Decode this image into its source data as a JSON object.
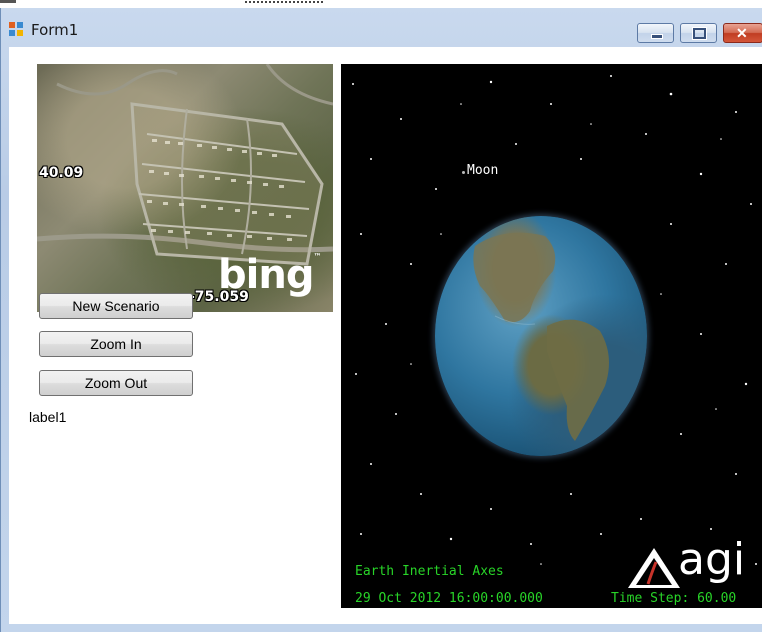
{
  "window": {
    "title": "Form1",
    "minimize_label": "minimize",
    "maximize_label": "maximize",
    "close_label": "close",
    "close_glyph": "✕"
  },
  "map": {
    "provider_logo": "bing",
    "latitude_label": "40.09",
    "longitude_label": "-75.059"
  },
  "buttons": {
    "new_scenario": "New Scenario",
    "zoom_in": "Zoom In",
    "zoom_out": "Zoom Out"
  },
  "label1": "label1",
  "globe": {
    "moon_label": "Moon",
    "axes_text": "Earth Inertial Axes",
    "time_text": "29 Oct 2012 16:00:00.000",
    "time_step_text": "Time Step: 60.00",
    "logo_text": "agi"
  },
  "colors": {
    "hud_text": "#28d428",
    "globe_background": "#000000",
    "close_button": "#c03d22"
  }
}
